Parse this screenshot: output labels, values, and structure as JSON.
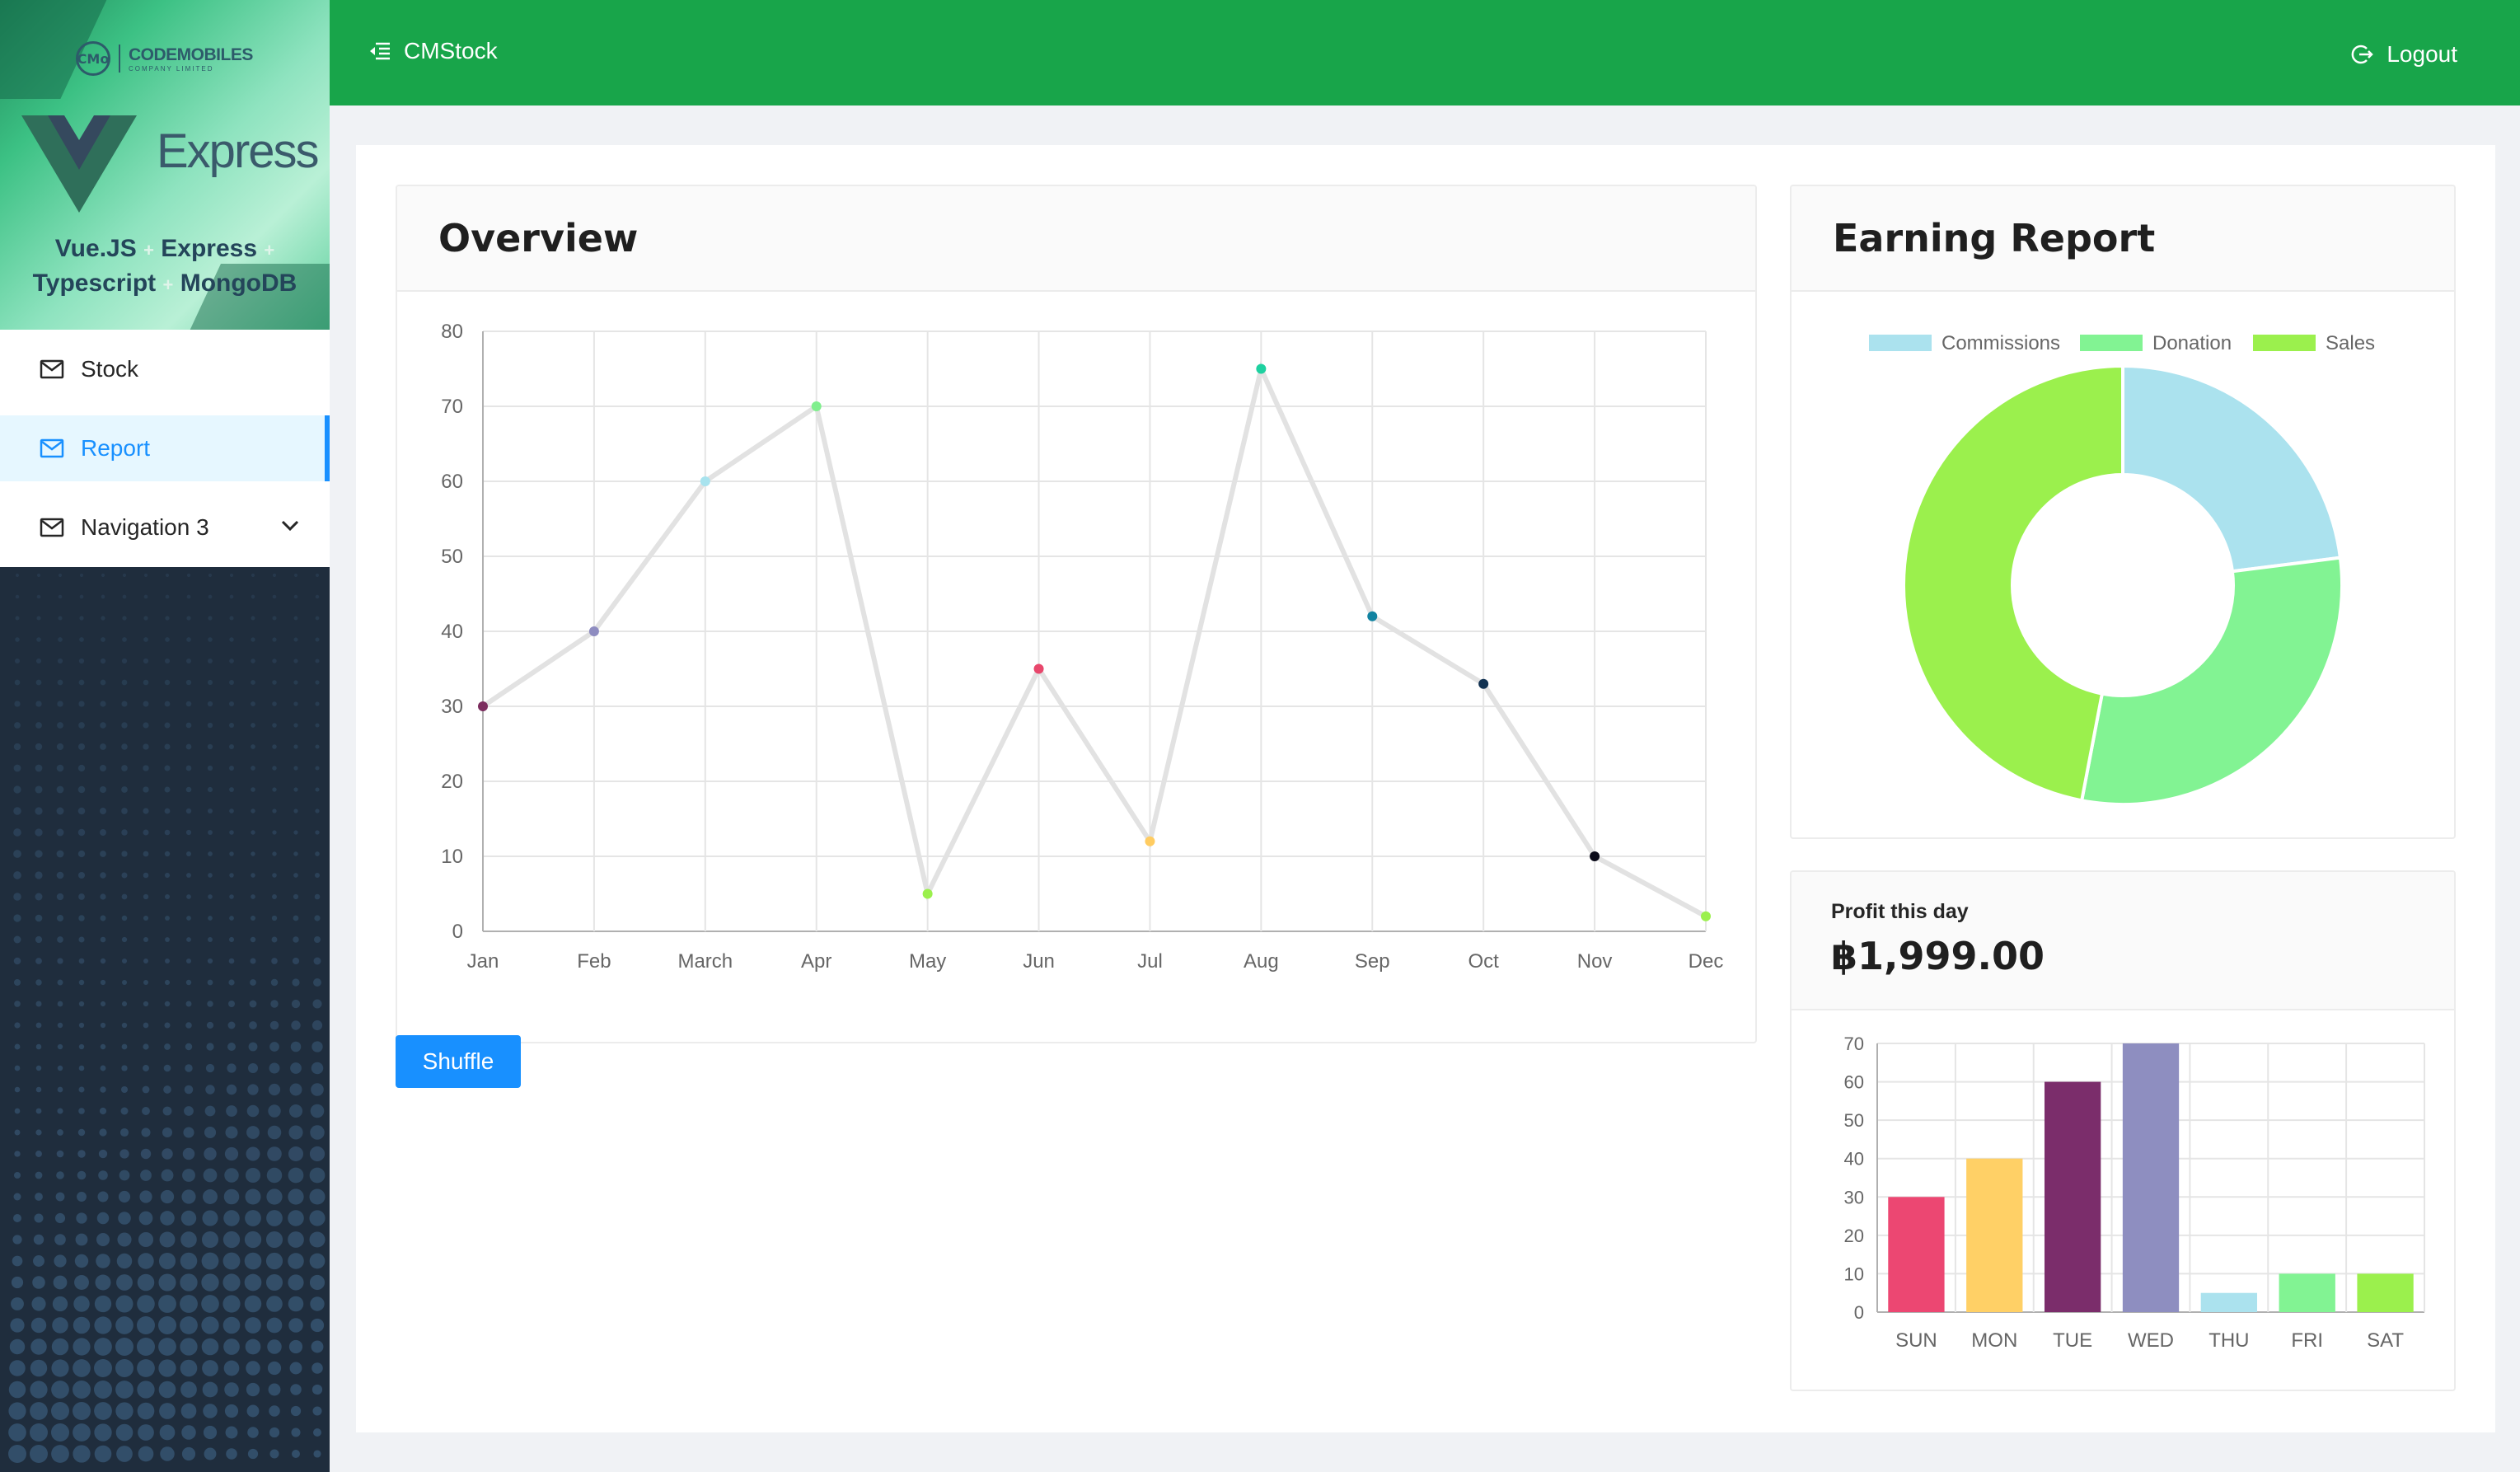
{
  "brand": {
    "company": "CODEMOBILES",
    "company_sub": "COMPANY LIMITED",
    "logo_mark": "CMo",
    "product": "Express",
    "tech_line1": [
      "Vue.JS",
      "Express"
    ],
    "tech_line2": [
      "Typescript",
      "MongoDB"
    ],
    "plus": "+"
  },
  "sidebar": {
    "items": [
      {
        "label": "Stock",
        "icon": "mail-icon"
      },
      {
        "label": "Report",
        "icon": "mail-icon",
        "active": true
      },
      {
        "label": "Navigation 3",
        "icon": "mail-icon",
        "has_submenu": true
      }
    ]
  },
  "header": {
    "title": "CMStock",
    "logout_label": "Logout",
    "bg_color": "#18a54a"
  },
  "overview": {
    "title": "Overview",
    "shuffle_label": "Shuffle"
  },
  "earning": {
    "title": "Earning Report"
  },
  "profit": {
    "label": "Profit this day",
    "value": "฿1,999.00"
  },
  "chart_data": [
    {
      "type": "line",
      "categories": [
        "Jan",
        "Feb",
        "March",
        "Apr",
        "May",
        "Jun",
        "Jul",
        "Aug",
        "Sep",
        "Oct",
        "Nov",
        "Dec"
      ],
      "values": [
        30,
        40,
        60,
        70,
        5,
        35,
        12,
        75,
        42,
        33,
        10,
        2
      ],
      "point_colors": [
        "#7b2d5e",
        "#8e8cc0",
        "#a8e3ee",
        "#80ef8e",
        "#9bf04d",
        "#e8476c",
        "#ffcc61",
        "#1ed1a0",
        "#1183a1",
        "#123252",
        "#0b0b1a",
        "#9bf04d"
      ],
      "line_color": "#e2e2e2",
      "ylim": [
        0,
        80
      ],
      "yticks": [
        0,
        10,
        20,
        30,
        40,
        50,
        60,
        70,
        80
      ],
      "grid": true
    },
    {
      "type": "pie",
      "donut": true,
      "legend_position": "top",
      "labels": [
        "Commissions",
        "Donation",
        "Sales"
      ],
      "values": [
        23,
        30,
        47
      ],
      "colors": [
        "#abe2ee",
        "#82f393",
        "#9bf04d"
      ]
    },
    {
      "type": "bar",
      "categories": [
        "SUN",
        "MON",
        "TUE",
        "WED",
        "THU",
        "FRI",
        "SAT"
      ],
      "values": [
        30,
        40,
        60,
        70,
        5,
        10,
        10
      ],
      "colors": [
        "#ec4772",
        "#ffd066",
        "#7b2d6b",
        "#8e8ec0",
        "#abe2ee",
        "#82f393",
        "#9bf04d"
      ],
      "ylim": [
        0,
        70
      ],
      "yticks": [
        0,
        10,
        20,
        30,
        40,
        50,
        60,
        70
      ],
      "grid": true
    }
  ]
}
